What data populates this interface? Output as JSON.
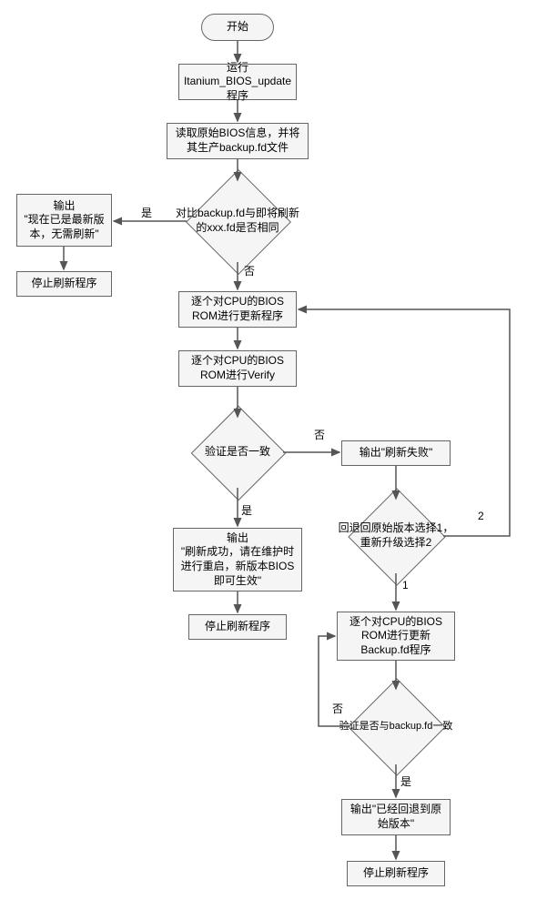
{
  "start": "开始",
  "run_program": "运行Itanium_BIOS_update程序",
  "read_bios": "读取原始BIOS信息，并将其生产backup.fd文件",
  "compare": "对比backup.fd与即将刷新的xxx.fd是否相同",
  "output_latest": "输出\n\"现在已是最新版本，无需刷新\"",
  "stop_refresh_1": "停止刷新程序",
  "update_cpu": "逐个对CPU的BIOS ROM进行更新程序",
  "verify_cpu": "逐个对CPU的BIOS ROM进行Verify",
  "verify_consistent": "验证是否一致",
  "output_success": "输出\n\"刷新成功，请在维护时进行重启，新版本BIOS即可生效\"",
  "stop_refresh_2": "停止刷新程序",
  "output_fail": "输出\"刷新失败\"",
  "rollback_choice": "回退回原始版本选择1，重新升级选择2",
  "update_backup": "逐个对CPU的BIOS ROM进行更新Backup.fd程序",
  "verify_backup": "验证是否与backup.fd一致",
  "output_rollback": "输出\"已经回退到原始版本\"",
  "stop_refresh_3": "停止刷新程序",
  "yes": "是",
  "no": "否",
  "opt1": "1",
  "opt2": "2"
}
